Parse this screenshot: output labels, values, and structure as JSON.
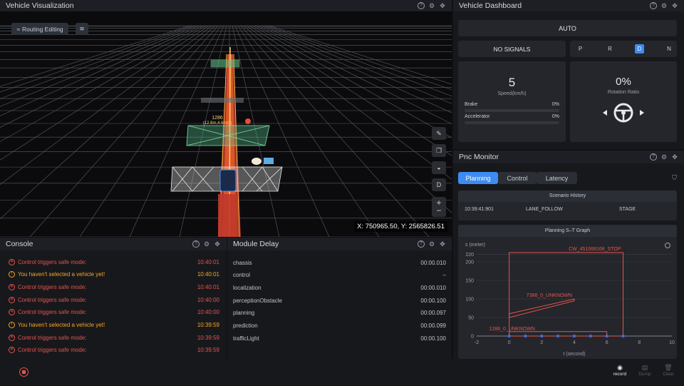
{
  "viz": {
    "title": "Vehicle Visualization",
    "routing_label": "Routing Editing",
    "coords": "X: 750965.50, Y: 2565826.51",
    "obstacle_label_1": "1286",
    "obstacle_label_2": "(12.8m,4.6m/s)",
    "side_d": "D"
  },
  "console": {
    "title": "Console",
    "rows": [
      {
        "type": "err",
        "msg": "Control triggers safe mode:",
        "time": "10:40:01"
      },
      {
        "type": "warn",
        "msg": "You haven't selected a vehicle yet!",
        "time": "10:40:01"
      },
      {
        "type": "err",
        "msg": "Control triggers safe mode:",
        "time": "10:40:01"
      },
      {
        "type": "err",
        "msg": "Control triggers safe mode:",
        "time": "10:40:00"
      },
      {
        "type": "err",
        "msg": "Control triggers safe mode:",
        "time": "10:40:00"
      },
      {
        "type": "warn",
        "msg": "You haven't selected a vehicle yet!",
        "time": "10:39:59"
      },
      {
        "type": "err",
        "msg": "Control triggers safe mode:",
        "time": "10:39:59"
      },
      {
        "type": "err",
        "msg": "Control triggers safe mode:",
        "time": "10:39:59"
      }
    ]
  },
  "delay": {
    "title": "Module Delay",
    "rows": [
      {
        "name": "chassis",
        "value": "00:00.010"
      },
      {
        "name": "control",
        "value": "–"
      },
      {
        "name": "localization",
        "value": "00:00.010"
      },
      {
        "name": "perceptionObstacle",
        "value": "00:00.100"
      },
      {
        "name": "planning",
        "value": "00:00.097"
      },
      {
        "name": "prediction",
        "value": "00:00.099"
      },
      {
        "name": "trafficLight",
        "value": "00:00.100"
      }
    ]
  },
  "dash": {
    "title": "Vehicle Dashboard",
    "mode": "AUTO",
    "signals": "NO SIGNALS",
    "gears": [
      "P",
      "R",
      "D",
      "N"
    ],
    "active_gear": "D",
    "speed": "5",
    "speed_label": "Speed(km/h)",
    "brake_label": "Brake",
    "brake_value": "0%",
    "brake_level": 0,
    "accel_label": "Accelerator",
    "accel_value": "0%",
    "accel_level": 0,
    "rotation": "0%",
    "rotation_label": "Rotation Ratio"
  },
  "pnc": {
    "title": "Pnc Monitor",
    "tabs": [
      "Planning",
      "Control",
      "Latency"
    ],
    "active_tab": "Planning",
    "history_title": "Scenario History",
    "history_time": "10:39:41:901",
    "history_scenario": "LANE_FOLLOW",
    "history_stage": "STAGE",
    "graph_title": "Planning S–T Graph",
    "ylabel": "s (meter)",
    "xlabel": "t (second)"
  },
  "chart_data": {
    "type": "line",
    "title": "Planning S–T Graph",
    "xlabel": "t (second)",
    "ylabel": "s (meter)",
    "xlim": [
      -2,
      10
    ],
    "ylim": [
      0,
      225
    ],
    "xticks": [
      -2,
      0,
      2,
      4,
      6,
      8,
      10
    ],
    "yticks": [
      0,
      50,
      100,
      150,
      200,
      220
    ],
    "series": [
      {
        "name": "CW_451068168_STOP",
        "polygon": [
          [
            0,
            0
          ],
          [
            7,
            0
          ],
          [
            7,
            225
          ],
          [
            0,
            225
          ]
        ]
      },
      {
        "name": "7386_0_UNKNOWN",
        "polygon": [
          [
            0,
            60
          ],
          [
            4,
            100
          ],
          [
            4,
            95
          ],
          [
            0,
            50
          ]
        ]
      },
      {
        "name": "1286_0_UNKNOWN",
        "polygon": [
          [
            0,
            0
          ],
          [
            6,
            0
          ],
          [
            6,
            12
          ],
          [
            0,
            12
          ]
        ]
      },
      {
        "name": "",
        "points": [
          [
            0,
            0
          ],
          [
            1,
            0
          ],
          [
            2,
            0
          ],
          [
            3,
            0
          ],
          [
            4,
            0
          ],
          [
            5,
            0
          ],
          [
            6,
            0
          ],
          [
            7,
            0
          ]
        ]
      }
    ]
  },
  "bottom": {
    "record": "record",
    "dump": "Dump",
    "clear": "Clear"
  }
}
